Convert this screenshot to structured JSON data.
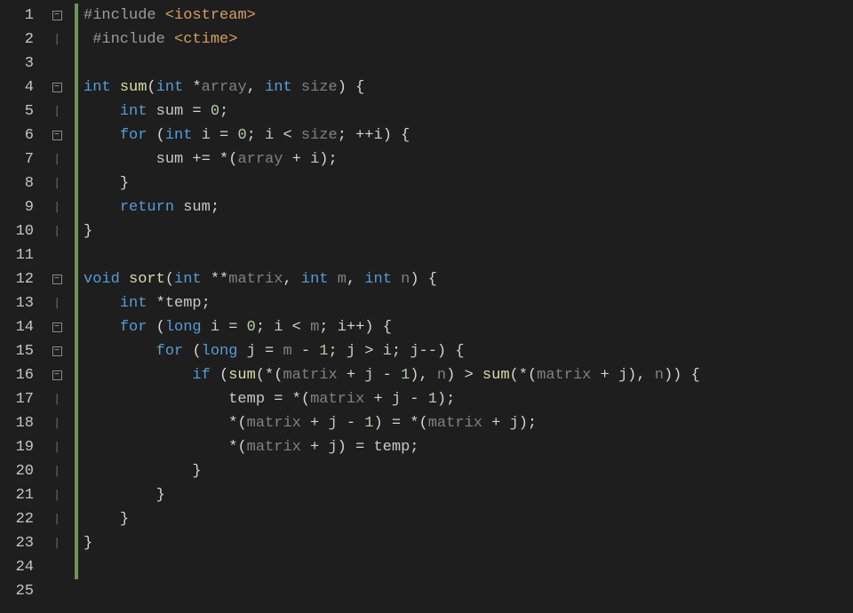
{
  "lines": [
    {
      "num": "1",
      "fold": "minus",
      "guide": "",
      "tokens": [
        [
          "pp",
          "#include "
        ],
        [
          "inc",
          "<iostream>"
        ]
      ]
    },
    {
      "num": "2",
      "fold": "pipe",
      "guide": " ",
      "tokens": [
        [
          "pp",
          "#include "
        ],
        [
          "inc",
          "<ctime>"
        ]
      ]
    },
    {
      "num": "3",
      "fold": "",
      "guide": "",
      "tokens": []
    },
    {
      "num": "4",
      "fold": "minus",
      "guide": "",
      "tokens": [
        [
          "kw",
          "int "
        ],
        [
          "fn",
          "sum"
        ],
        [
          "punc",
          "("
        ],
        [
          "kw",
          "int "
        ],
        [
          "op",
          "*"
        ],
        [
          "param",
          "array"
        ],
        [
          "punc",
          ", "
        ],
        [
          "kw",
          "int "
        ],
        [
          "param",
          "size"
        ],
        [
          "punc",
          ") {"
        ]
      ]
    },
    {
      "num": "5",
      "fold": "pipe",
      "guide": "    ",
      "tokens": [
        [
          "kw",
          "int "
        ],
        [
          "id",
          "sum"
        ],
        [
          "op",
          " = "
        ],
        [
          "num",
          "0"
        ],
        [
          "punc",
          ";"
        ]
      ]
    },
    {
      "num": "6",
      "fold": "minus",
      "guide": "    ",
      "tokens": [
        [
          "kw",
          "for "
        ],
        [
          "punc",
          "("
        ],
        [
          "kw",
          "int "
        ],
        [
          "id",
          "i"
        ],
        [
          "op",
          " = "
        ],
        [
          "num",
          "0"
        ],
        [
          "punc",
          "; "
        ],
        [
          "id",
          "i"
        ],
        [
          "op",
          " < "
        ],
        [
          "param",
          "size"
        ],
        [
          "punc",
          "; "
        ],
        [
          "op",
          "++"
        ],
        [
          "id",
          "i"
        ],
        [
          "punc",
          ") {"
        ]
      ]
    },
    {
      "num": "7",
      "fold": "pipe",
      "guide": "        ",
      "tokens": [
        [
          "id",
          "sum"
        ],
        [
          "op",
          " += *"
        ],
        [
          "punc",
          "("
        ],
        [
          "param",
          "array"
        ],
        [
          "op",
          " + "
        ],
        [
          "id",
          "i"
        ],
        [
          "punc",
          ");"
        ]
      ]
    },
    {
      "num": "8",
      "fold": "pipe",
      "guide": "    ",
      "tokens": [
        [
          "punc",
          "}"
        ]
      ]
    },
    {
      "num": "9",
      "fold": "pipe",
      "guide": "    ",
      "tokens": [
        [
          "kw",
          "return "
        ],
        [
          "id",
          "sum"
        ],
        [
          "punc",
          ";"
        ]
      ]
    },
    {
      "num": "10",
      "fold": "pipe",
      "guide": "",
      "tokens": [
        [
          "punc",
          "}"
        ]
      ]
    },
    {
      "num": "11",
      "fold": "",
      "guide": "",
      "tokens": []
    },
    {
      "num": "12",
      "fold": "minus",
      "guide": "",
      "tokens": [
        [
          "kw",
          "void "
        ],
        [
          "fn",
          "sort"
        ],
        [
          "punc",
          "("
        ],
        [
          "kw",
          "int "
        ],
        [
          "op",
          "**"
        ],
        [
          "param",
          "matrix"
        ],
        [
          "punc",
          ", "
        ],
        [
          "kw",
          "int "
        ],
        [
          "param",
          "m"
        ],
        [
          "punc",
          ", "
        ],
        [
          "kw",
          "int "
        ],
        [
          "param",
          "n"
        ],
        [
          "punc",
          ") {"
        ]
      ]
    },
    {
      "num": "13",
      "fold": "pipe",
      "guide": "    ",
      "tokens": [
        [
          "kw",
          "int "
        ],
        [
          "op",
          "*"
        ],
        [
          "id",
          "temp"
        ],
        [
          "punc",
          ";"
        ]
      ]
    },
    {
      "num": "14",
      "fold": "minus",
      "guide": "    ",
      "tokens": [
        [
          "kw",
          "for "
        ],
        [
          "punc",
          "("
        ],
        [
          "kw",
          "long "
        ],
        [
          "id",
          "i"
        ],
        [
          "op",
          " = "
        ],
        [
          "num",
          "0"
        ],
        [
          "punc",
          "; "
        ],
        [
          "id",
          "i"
        ],
        [
          "op",
          " < "
        ],
        [
          "param",
          "m"
        ],
        [
          "punc",
          "; "
        ],
        [
          "id",
          "i"
        ],
        [
          "op",
          "++"
        ],
        [
          "punc",
          ") {"
        ]
      ]
    },
    {
      "num": "15",
      "fold": "minus",
      "guide": "        ",
      "tokens": [
        [
          "kw",
          "for "
        ],
        [
          "punc",
          "("
        ],
        [
          "kw",
          "long "
        ],
        [
          "id",
          "j"
        ],
        [
          "op",
          " = "
        ],
        [
          "param",
          "m"
        ],
        [
          "op",
          " - "
        ],
        [
          "num",
          "1"
        ],
        [
          "punc",
          "; "
        ],
        [
          "id",
          "j"
        ],
        [
          "op",
          " > "
        ],
        [
          "id",
          "i"
        ],
        [
          "punc",
          "; "
        ],
        [
          "id",
          "j"
        ],
        [
          "op",
          "--"
        ],
        [
          "punc",
          ") {"
        ]
      ]
    },
    {
      "num": "16",
      "fold": "minus",
      "guide": "            ",
      "tokens": [
        [
          "kw",
          "if "
        ],
        [
          "punc",
          "("
        ],
        [
          "fn",
          "sum"
        ],
        [
          "punc",
          "("
        ],
        [
          "op",
          "*"
        ],
        [
          "punc",
          "("
        ],
        [
          "param",
          "matrix"
        ],
        [
          "op",
          " + "
        ],
        [
          "id",
          "j"
        ],
        [
          "op",
          " - "
        ],
        [
          "num",
          "1"
        ],
        [
          "punc",
          "), "
        ],
        [
          "param",
          "n"
        ],
        [
          "punc",
          ") "
        ],
        [
          "op",
          ">"
        ],
        [
          "punc",
          " "
        ],
        [
          "fn",
          "sum"
        ],
        [
          "punc",
          "("
        ],
        [
          "op",
          "*"
        ],
        [
          "punc",
          "("
        ],
        [
          "param",
          "matrix"
        ],
        [
          "op",
          " + "
        ],
        [
          "id",
          "j"
        ],
        [
          "punc",
          "), "
        ],
        [
          "param",
          "n"
        ],
        [
          "punc",
          ")) {"
        ]
      ]
    },
    {
      "num": "17",
      "fold": "pipe",
      "guide": "                ",
      "tokens": [
        [
          "id",
          "temp"
        ],
        [
          "op",
          " = *"
        ],
        [
          "punc",
          "("
        ],
        [
          "param",
          "matrix"
        ],
        [
          "op",
          " + "
        ],
        [
          "id",
          "j"
        ],
        [
          "op",
          " - "
        ],
        [
          "num",
          "1"
        ],
        [
          "punc",
          ");"
        ]
      ]
    },
    {
      "num": "18",
      "fold": "pipe",
      "guide": "                ",
      "tokens": [
        [
          "op",
          "*"
        ],
        [
          "punc",
          "("
        ],
        [
          "param",
          "matrix"
        ],
        [
          "op",
          " + "
        ],
        [
          "id",
          "j"
        ],
        [
          "op",
          " - "
        ],
        [
          "num",
          "1"
        ],
        [
          "punc",
          ")"
        ],
        [
          "op",
          " = *"
        ],
        [
          "punc",
          "("
        ],
        [
          "param",
          "matrix"
        ],
        [
          "op",
          " + "
        ],
        [
          "id",
          "j"
        ],
        [
          "punc",
          ");"
        ]
      ]
    },
    {
      "num": "19",
      "fold": "pipe",
      "guide": "                ",
      "tokens": [
        [
          "op",
          "*"
        ],
        [
          "punc",
          "("
        ],
        [
          "param",
          "matrix"
        ],
        [
          "op",
          " + "
        ],
        [
          "id",
          "j"
        ],
        [
          "punc",
          ")"
        ],
        [
          "op",
          " = "
        ],
        [
          "id",
          "temp"
        ],
        [
          "punc",
          ";"
        ]
      ]
    },
    {
      "num": "20",
      "fold": "pipe",
      "guide": "            ",
      "tokens": [
        [
          "punc",
          "}"
        ]
      ]
    },
    {
      "num": "21",
      "fold": "pipe",
      "guide": "        ",
      "tokens": [
        [
          "punc",
          "}"
        ]
      ]
    },
    {
      "num": "22",
      "fold": "pipe",
      "guide": "    ",
      "tokens": [
        [
          "punc",
          "}"
        ]
      ]
    },
    {
      "num": "23",
      "fold": "pipe",
      "guide": "",
      "tokens": [
        [
          "punc",
          "}"
        ]
      ]
    },
    {
      "num": "24",
      "fold": "",
      "guide": "",
      "tokens": []
    },
    {
      "num": "25",
      "fold": "",
      "guide": "",
      "tokens": []
    }
  ],
  "tokenColors": {
    "pp": "#9b9b9b",
    "inc": "#d69d62",
    "kw": "#569cd6",
    "fn": "#dcdcaa",
    "id": "#c8c8c8",
    "param": "#808080",
    "num": "#b5cea8",
    "op": "#d4d4d4",
    "punc": "#d4d4d4"
  }
}
